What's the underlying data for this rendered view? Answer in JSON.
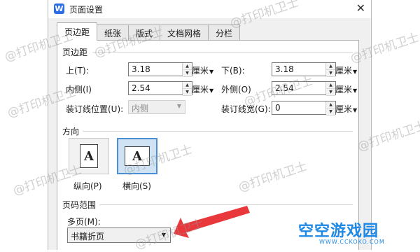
{
  "window": {
    "icon_letter": "W",
    "title": "页面设置",
    "close_glyph": "✕"
  },
  "tabs": [
    {
      "label": "页边距",
      "active": true
    },
    {
      "label": "纸张",
      "active": false
    },
    {
      "label": "版式",
      "active": false
    },
    {
      "label": "文档网格",
      "active": false
    },
    {
      "label": "分栏",
      "active": false
    }
  ],
  "margins": {
    "section_title": "页边距",
    "top": {
      "label": "上(T):",
      "value": "3.18",
      "unit": "厘米"
    },
    "bottom": {
      "label": "下(B):",
      "value": "3.18",
      "unit": "厘米"
    },
    "inside": {
      "label": "内侧(I)",
      "value": "2.54",
      "unit": "厘米"
    },
    "outside": {
      "label": "外侧(O)",
      "value": "2.54",
      "unit": "厘米"
    },
    "gutter_pos": {
      "label": "装订线位置(U):",
      "value": "内侧"
    },
    "gutter_width": {
      "label": "装订线宽(G):",
      "value": "0",
      "unit": "厘米"
    }
  },
  "orientation": {
    "section_title": "方向",
    "portrait": {
      "label": "纵向(P)",
      "glyph": "A",
      "selected": false
    },
    "landscape": {
      "label": "横向(S)",
      "glyph": "A",
      "selected": true
    }
  },
  "pages": {
    "section_title": "页码范围",
    "multiple_label": "多页(M):",
    "multiple_value": "书籍折页"
  },
  "watermark_text": "@打印机卫士",
  "logo": {
    "brand": "空空游戏园",
    "site": "WWW.CCKOKO.COM"
  },
  "colors": {
    "accent": "#4a8fd3",
    "arrow": "#e8383b",
    "brand": "#1e88e5"
  }
}
